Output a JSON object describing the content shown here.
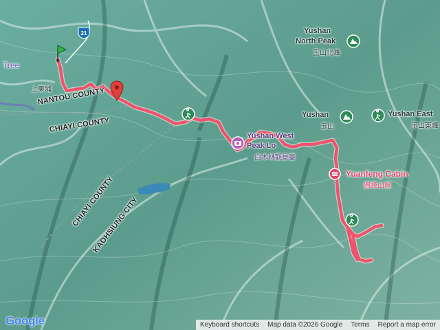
{
  "map": {
    "places": {
      "north_peak_en": "Yushan",
      "north_peak_en2": "North Peak",
      "north_peak_cjk": "玉山北峰",
      "yushan_en": "Yushan",
      "yushan_cjk": "玉山",
      "east_en": "Yushan East",
      "east_cjk": "玉山東峰",
      "west_peak_en": "Yushan West",
      "west_peak_en2": "Peak Lo",
      "west_peak_cjk": "白木林觀景臺",
      "tree": "Tree",
      "shangdongpu": "上東埔",
      "cabin_en": "Yuanfeng Cabin",
      "cabin_cjk": "圓峰山屋"
    },
    "boundaries": {
      "nantou": "NANTOU COUNTY",
      "chiayi_top": "CHIAYI COUNTY",
      "chiayi_diag": "CHIAYI COUNTY",
      "kaohsiung": "KAOHSIUNG CITY"
    },
    "road_shield": "21",
    "route_color": "#f0536b",
    "attribution": {
      "keyboard": "Keyboard shortcuts",
      "data": "Map data ©2026 Google",
      "terms": "Terms",
      "report": "Report a map error"
    },
    "logo": "Google",
    "icons": [
      "start-flag-icon",
      "end-pin-icon",
      "mountain-peak-icon",
      "camera-viewpoint-icon",
      "cabin-icon"
    ]
  }
}
